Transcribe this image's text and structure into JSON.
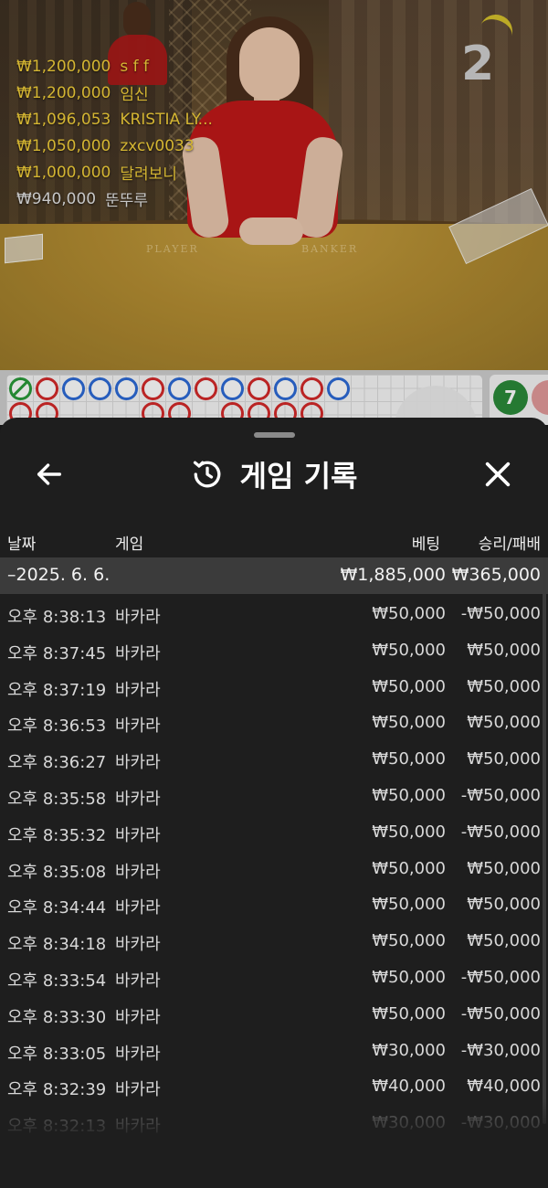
{
  "video": {
    "round_number": "2",
    "table_labels": {
      "player": "PLAYER",
      "banker": "BANKER"
    },
    "winners": [
      {
        "amount": "₩1,200,000",
        "name": "s f f",
        "style": "gold"
      },
      {
        "amount": "₩1,200,000",
        "name": "임신",
        "style": "gold"
      },
      {
        "amount": "₩1,096,053",
        "name": "KRISTIA LY...",
        "style": "gold"
      },
      {
        "amount": "₩1,050,000",
        "name": "zxcv0033",
        "style": "gold"
      },
      {
        "amount": "₩1,000,000",
        "name": "달려보니",
        "style": "gold"
      },
      {
        "amount": "₩940,000",
        "name": "뚠뚜루",
        "style": "grey"
      }
    ]
  },
  "roadmap": {
    "beads_row1": [
      "green",
      "red",
      "blue",
      "blue",
      "blue",
      "red",
      "blue",
      "red",
      "blue",
      "red",
      "blue",
      "red",
      "blue"
    ],
    "beads_row2": [
      "red",
      "red",
      "red",
      "red",
      "red",
      "red",
      "red",
      "red"
    ],
    "counter": "7",
    "colors": {
      "player": "#2d6ad6",
      "banker": "#d42a2a",
      "tie": "#2a9a3a"
    }
  },
  "sheet": {
    "title": "게임 기록",
    "back_icon": "arrow-left-icon",
    "title_icon": "history-icon",
    "close_icon": "close-icon",
    "columns": {
      "date": "날짜",
      "game": "게임",
      "bet": "베팅",
      "result": "승리/패배"
    },
    "date_group": {
      "label": "–2025. 6. 6.",
      "bet_total": "₩1,885,000",
      "result_total": "₩365,000"
    },
    "rows": [
      {
        "time": "오후 8:38:13",
        "game": "바카라",
        "bet": "₩50,000",
        "result": "-₩50,000"
      },
      {
        "time": "오후 8:37:45",
        "game": "바카라",
        "bet": "₩50,000",
        "result": "₩50,000"
      },
      {
        "time": "오후 8:37:19",
        "game": "바카라",
        "bet": "₩50,000",
        "result": "₩50,000"
      },
      {
        "time": "오후 8:36:53",
        "game": "바카라",
        "bet": "₩50,000",
        "result": "₩50,000"
      },
      {
        "time": "오후 8:36:27",
        "game": "바카라",
        "bet": "₩50,000",
        "result": "₩50,000"
      },
      {
        "time": "오후 8:35:58",
        "game": "바카라",
        "bet": "₩50,000",
        "result": "-₩50,000"
      },
      {
        "time": "오후 8:35:32",
        "game": "바카라",
        "bet": "₩50,000",
        "result": "-₩50,000"
      },
      {
        "time": "오후 8:35:08",
        "game": "바카라",
        "bet": "₩50,000",
        "result": "₩50,000"
      },
      {
        "time": "오후 8:34:44",
        "game": "바카라",
        "bet": "₩50,000",
        "result": "₩50,000"
      },
      {
        "time": "오후 8:34:18",
        "game": "바카라",
        "bet": "₩50,000",
        "result": "₩50,000"
      },
      {
        "time": "오후 8:33:54",
        "game": "바카라",
        "bet": "₩50,000",
        "result": "-₩50,000"
      },
      {
        "time": "오후 8:33:30",
        "game": "바카라",
        "bet": "₩50,000",
        "result": "-₩50,000"
      },
      {
        "time": "오후 8:33:05",
        "game": "바카라",
        "bet": "₩30,000",
        "result": "-₩30,000"
      },
      {
        "time": "오후 8:32:39",
        "game": "바카라",
        "bet": "₩40,000",
        "result": "₩40,000"
      },
      {
        "time": "오후 8:32:13",
        "game": "바카라",
        "bet": "₩30,000",
        "result": "-₩30,000"
      }
    ]
  }
}
